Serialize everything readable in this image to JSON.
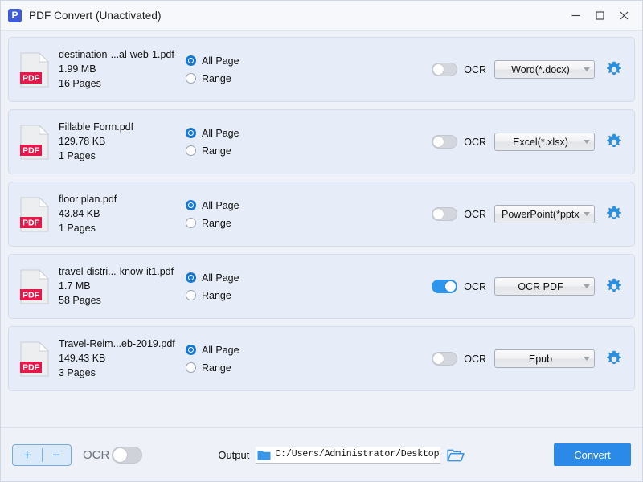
{
  "window": {
    "title": "PDF Convert (Unactivated)",
    "app_icon": "pdf-convert-logo",
    "minimize_label": "—",
    "maximize_label": "□",
    "close_label": "✕"
  },
  "colors": {
    "accent_blue": "#2b8ae8",
    "toggle_on": "#2f95ec",
    "radio_on": "#1678d4",
    "pdf_red": "#e8174a",
    "card_bg": "#e7edf8",
    "window_bg": "#eef1f8"
  },
  "files": [
    {
      "name": "destination-...al-web-1.pdf",
      "size": "1.99 MB",
      "pages": "16 Pages",
      "range_mode": "all",
      "all_page_label": "All Page",
      "range_label": "Range",
      "ocr_label": "OCR",
      "ocr_enabled": false,
      "format": "Word(*.docx)"
    },
    {
      "name": "Fillable Form.pdf",
      "size": "129.78 KB",
      "pages": "1 Pages",
      "range_mode": "all",
      "all_page_label": "All Page",
      "range_label": "Range",
      "ocr_label": "OCR",
      "ocr_enabled": false,
      "format": "Excel(*.xlsx)"
    },
    {
      "name": "floor plan.pdf",
      "size": "43.84 KB",
      "pages": "1 Pages",
      "range_mode": "all",
      "all_page_label": "All Page",
      "range_label": "Range",
      "ocr_label": "OCR",
      "ocr_enabled": false,
      "format": "PowerPoint(*pptx)"
    },
    {
      "name": "travel-distri...-know-it1.pdf",
      "size": "1.7 MB",
      "pages": "58 Pages",
      "range_mode": "all",
      "all_page_label": "All Page",
      "range_label": "Range",
      "ocr_label": "OCR",
      "ocr_enabled": true,
      "format": "OCR PDF"
    },
    {
      "name": "Travel-Reim...eb-2019.pdf",
      "size": "149.43 KB",
      "pages": "3 Pages",
      "range_mode": "all",
      "all_page_label": "All Page",
      "range_label": "Range",
      "ocr_label": "OCR",
      "ocr_enabled": false,
      "format": "Epub"
    }
  ],
  "bottom": {
    "add_label": "+",
    "remove_label": "−",
    "ocr_label": "OCR",
    "ocr_enabled": false,
    "output_label": "Output",
    "output_path": "C:/Users/Administrator/Desktop",
    "browse_icon": "open-folder-icon",
    "convert_label": "Convert"
  }
}
